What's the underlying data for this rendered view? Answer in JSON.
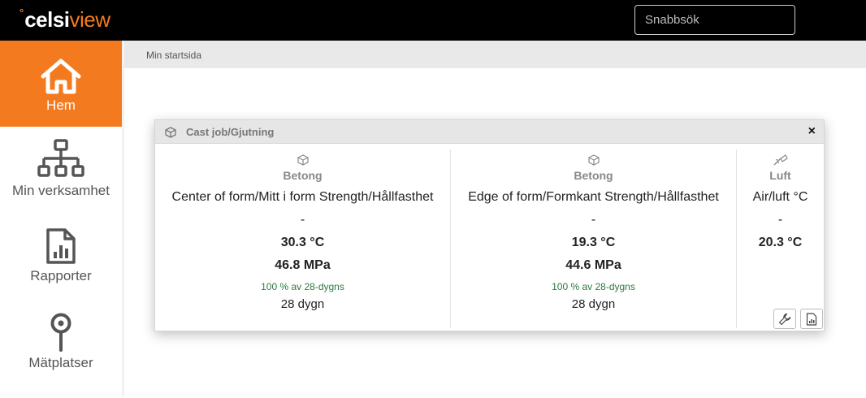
{
  "header": {
    "logo_degree": "°",
    "logo_celsi": "celsi",
    "logo_view": "view",
    "search_placeholder": "Snabbsök"
  },
  "sidebar": {
    "items": [
      {
        "label": "Hem",
        "icon": "home-icon",
        "active": true
      },
      {
        "label": "Min verksamhet",
        "icon": "org-chart-icon",
        "active": false
      },
      {
        "label": "Rapporter",
        "icon": "report-icon",
        "active": false
      },
      {
        "label": "Mätplatser",
        "icon": "map-pin-icon",
        "active": false
      }
    ]
  },
  "breadcrumb": "Min startsida",
  "widget": {
    "title": "Cast job/Gjutning",
    "close_label": "×",
    "columns": [
      {
        "type": "Betong",
        "icon": "cube-icon",
        "name": "Center of form/Mitt i form Strength/Hållfasthet",
        "dash": "-",
        "temperature": "30.3 °C",
        "strength": "46.8 MPa",
        "percent": "100 % av 28-dygns",
        "days": "28 dygn"
      },
      {
        "type": "Betong",
        "icon": "cube-icon",
        "name": "Edge of form/Formkant Strength/Hållfasthet",
        "dash": "-",
        "temperature": "19.3 °C",
        "strength": "44.6 MPa",
        "percent": "100 % av 28-dygns",
        "days": "28 dygn"
      },
      {
        "type": "Luft",
        "icon": "wind-icon",
        "name": "Air/luft °C",
        "dash": "-",
        "temperature": "20.3 °C"
      }
    ],
    "buttons": [
      {
        "icon": "wrench-icon"
      },
      {
        "icon": "report-file-icon"
      }
    ]
  },
  "colors": {
    "accent": "#f47a1f",
    "topbar": "#000000",
    "success_text": "#2b7a3d"
  }
}
